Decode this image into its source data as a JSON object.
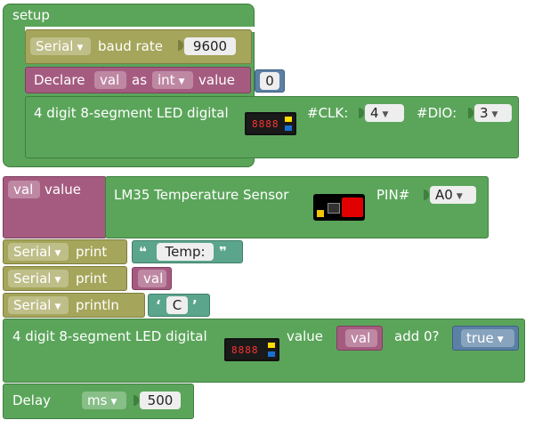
{
  "setup": {
    "label": "setup",
    "serial_baud": {
      "serial": "Serial",
      "label": "baud rate",
      "value": "9600"
    },
    "declare": {
      "label": "Declare",
      "var": "val",
      "as": "as",
      "type": "int",
      "value_label": "value",
      "value": "0"
    },
    "led_init": {
      "label": "4 digit 8-segment LED digital",
      "clk_label": "#CLK:",
      "clk": "4",
      "dio_label": "#DIO:",
      "dio": "3"
    }
  },
  "loop": {
    "assign": {
      "var": "val",
      "value_label": "value",
      "sensor_label": "LM35 Temperature Sensor",
      "pin_label": "PIN#",
      "pin": "A0"
    },
    "print1": {
      "serial": "Serial",
      "method": "print",
      "open_quote": "❝",
      "text": "Temp:",
      "close_quote": "❞"
    },
    "print2": {
      "serial": "Serial",
      "method": "print",
      "var": "val"
    },
    "println": {
      "serial": "Serial",
      "method": "println",
      "open_quote": "‘",
      "text": "C",
      "close_quote": "’"
    },
    "led_display": {
      "label": "4 digit 8-segment LED digital",
      "value_label": "value",
      "var": "val",
      "add0_label": "add 0?",
      "add0": "true"
    },
    "delay": {
      "label": "Delay",
      "unit_label": "ms",
      "unit": "ms",
      "value": "500"
    }
  },
  "colors": {
    "green": "#5ba55b",
    "olive": "#a5a55b",
    "magenta": "#a55b80",
    "teal": "#5ba58c",
    "blue": "#5b80a5"
  },
  "icons": [
    "led-display-icon",
    "temperature-sensor-icon",
    "dropdown-arrow-icon"
  ]
}
